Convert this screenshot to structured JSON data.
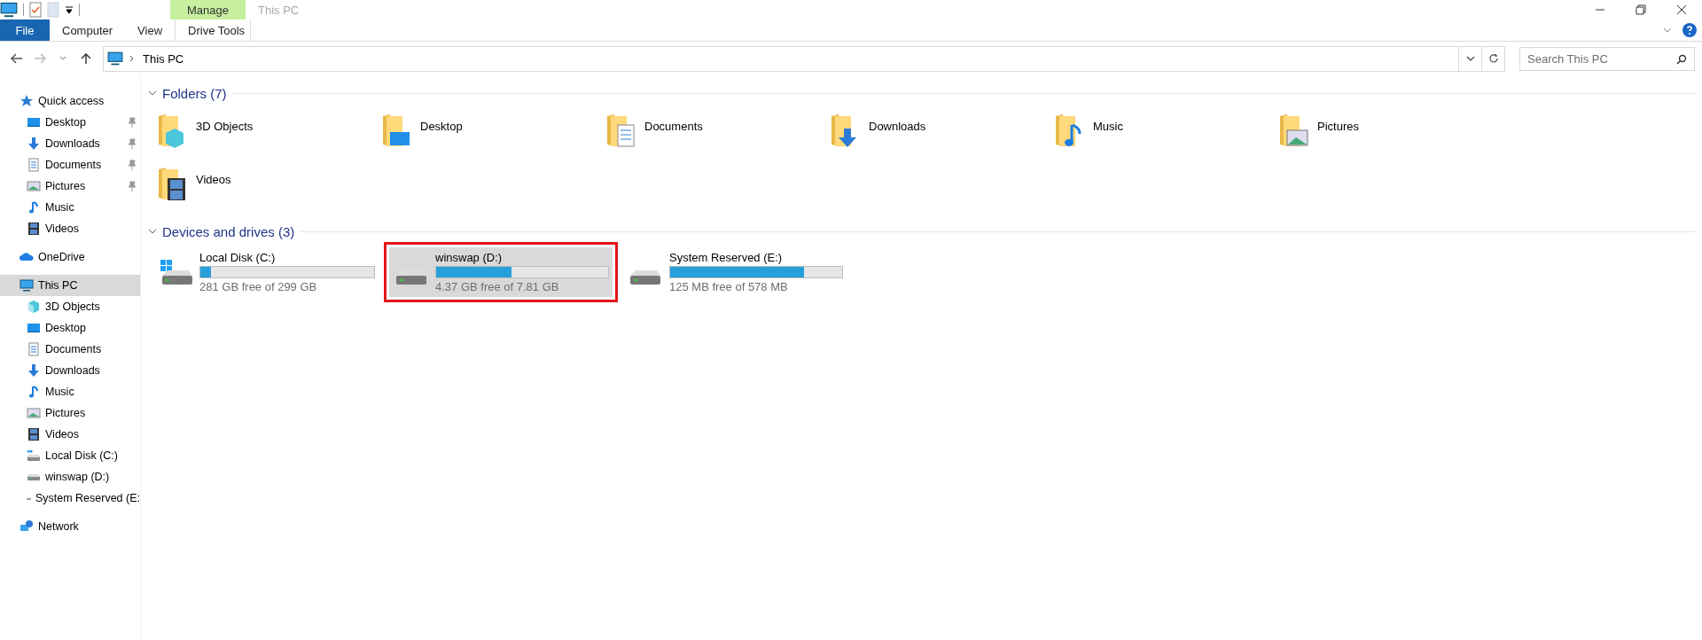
{
  "window": {
    "title": "This PC",
    "context_group": "Manage"
  },
  "ribbon": {
    "tabs": [
      {
        "label": "File",
        "kind": "file"
      },
      {
        "label": "Computer",
        "kind": "plain"
      },
      {
        "label": "View",
        "kind": "plain"
      },
      {
        "label": "Drive Tools",
        "kind": "context"
      }
    ]
  },
  "address": {
    "path": [
      "This PC"
    ],
    "search_placeholder": "Search This PC"
  },
  "sidebar": {
    "items": [
      {
        "label": "Quick access",
        "kind": "star",
        "selected": false,
        "children": [
          {
            "label": "Desktop",
            "kind": "desktop",
            "pinned": true,
            "selected": false
          },
          {
            "label": "Downloads",
            "kind": "downloads",
            "pinned": true,
            "selected": false
          },
          {
            "label": "Documents",
            "kind": "documents",
            "pinned": true,
            "selected": false
          },
          {
            "label": "Pictures",
            "kind": "pictures",
            "pinned": true,
            "selected": false
          },
          {
            "label": "Music",
            "kind": "music",
            "pinned": false,
            "selected": false
          },
          {
            "label": "Videos",
            "kind": "videos",
            "pinned": false,
            "selected": false
          }
        ]
      },
      {
        "label": "OneDrive",
        "kind": "cloud",
        "selected": false
      },
      {
        "label": "This PC",
        "kind": "pc",
        "selected": true,
        "children": [
          {
            "label": "3D Objects",
            "kind": "objects",
            "pinned": false,
            "selected": false
          },
          {
            "label": "Desktop",
            "kind": "desktop",
            "pinned": false,
            "selected": false
          },
          {
            "label": "Documents",
            "kind": "documents",
            "pinned": false,
            "selected": false
          },
          {
            "label": "Downloads",
            "kind": "downloads",
            "pinned": false,
            "selected": false
          },
          {
            "label": "Music",
            "kind": "music",
            "pinned": false,
            "selected": false
          },
          {
            "label": "Pictures",
            "kind": "pictures",
            "pinned": false,
            "selected": false
          },
          {
            "label": "Videos",
            "kind": "videos",
            "pinned": false,
            "selected": false
          },
          {
            "label": "Local Disk (C:)",
            "kind": "sysdrive",
            "pinned": false,
            "selected": false
          },
          {
            "label": "winswap (D:)",
            "kind": "drive",
            "pinned": false,
            "selected": false
          },
          {
            "label": "System Reserved (E:",
            "kind": "drive",
            "pinned": false,
            "selected": false
          }
        ]
      },
      {
        "label": "Network",
        "kind": "network",
        "selected": false
      }
    ]
  },
  "folders": {
    "title": "Folders (7)",
    "items": [
      {
        "label": "3D Objects",
        "kind": "objects"
      },
      {
        "label": "Desktop",
        "kind": "desktop"
      },
      {
        "label": "Documents",
        "kind": "documents"
      },
      {
        "label": "Downloads",
        "kind": "downloads"
      },
      {
        "label": "Music",
        "kind": "music"
      },
      {
        "label": "Pictures",
        "kind": "pictures"
      },
      {
        "label": "Videos",
        "kind": "videos"
      }
    ]
  },
  "drives": {
    "title": "Devices and drives (3)",
    "items": [
      {
        "label": "Local Disk (C:)",
        "kind": "sysdrive",
        "level": 0.06,
        "free": "281 GB free of 299 GB",
        "selected": false
      },
      {
        "label": "winswap (D:)",
        "kind": "drive",
        "level": 0.44,
        "free": "4.37 GB free of 7.81 GB",
        "selected": true
      },
      {
        "label": "System Reserved (E:)",
        "kind": "drive",
        "level": 0.78,
        "free": "125 MB free of 578 MB",
        "selected": false
      }
    ]
  }
}
